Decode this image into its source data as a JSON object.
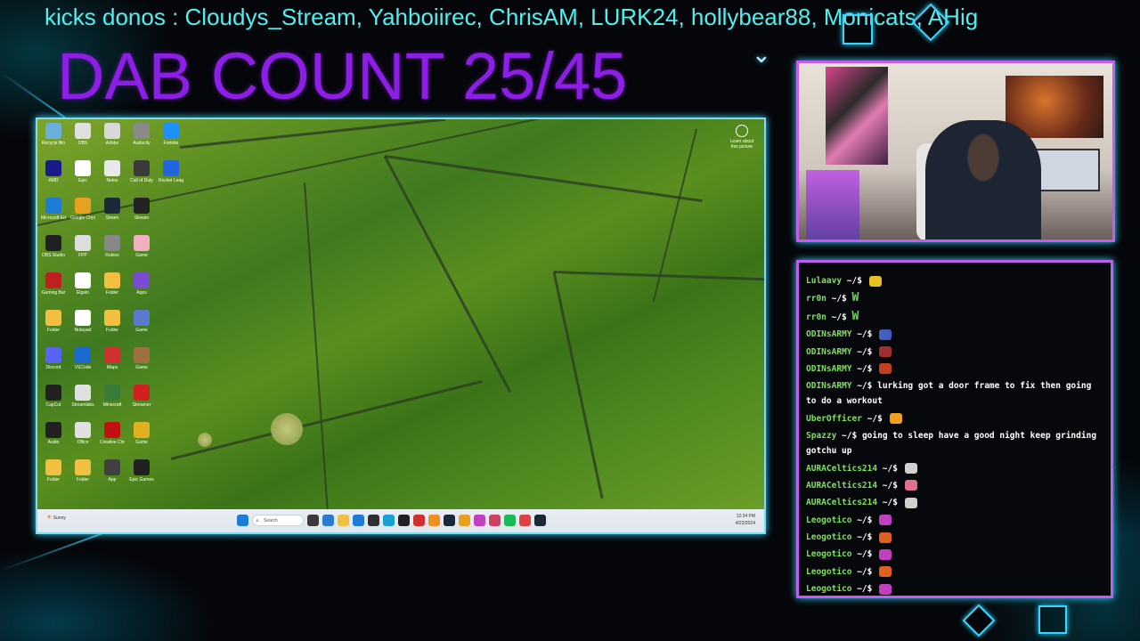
{
  "ticker": {
    "text": "kicks donos : Cloudys_Stream, Yahboiirec, ChrisAM, LURK24, hollybear88, Monicats, AHig"
  },
  "counter": {
    "text": "DAB COUNT 25/45"
  },
  "desktop": {
    "icons": [
      [
        "#6ab0d8",
        "Recycle Bin"
      ],
      [
        "#e0e0e0",
        "OBS"
      ],
      [
        "#d8d8d8",
        "Adobe"
      ],
      [
        "#8a8a8a",
        "Audacity"
      ],
      [
        "#1e90ff",
        "Fortnite"
      ],
      [
        "#1a1a8a",
        "AMD"
      ],
      [
        "#ffffff",
        "Epic"
      ],
      [
        "#e8e8e8",
        "Notes"
      ],
      [
        "#3a3a3a",
        "Call of Duty"
      ],
      [
        "#2266dd",
        "Rocket League"
      ],
      [
        "#1e7bd6",
        "Microsoft Edge"
      ],
      [
        "#e8a020",
        "Google Chrome"
      ],
      [
        "#1b2838",
        "Steam"
      ],
      [
        "#222222",
        "Stream"
      ],
      [
        "#202020",
        "OBS Studio"
      ],
      [
        "#dddddd",
        "FPP"
      ],
      [
        "#888888",
        "Roblox"
      ],
      [
        "#f0b0c0",
        "Game"
      ],
      [
        "#c02020",
        "Gaming Bar"
      ],
      [
        "#ffffff",
        "Elgato"
      ],
      [
        "#f0c040",
        "Folder"
      ],
      [
        "#7a4ad0",
        "Apps"
      ],
      [
        "#f0c040",
        "Folder"
      ],
      [
        "#ffffff",
        "Notepad"
      ],
      [
        "#f0c040",
        "Folder"
      ],
      [
        "#5a7ad0",
        "Game"
      ],
      [
        "#5865f2",
        "Discord"
      ],
      [
        "#1a6ad0",
        "VSCode"
      ],
      [
        "#d03030",
        "Maps"
      ],
      [
        "#a07040",
        "Game"
      ],
      [
        "#202020",
        "CapCut"
      ],
      [
        "#e0e0e0",
        "Streamlabs"
      ],
      [
        "#3a7a3a",
        "Minecraft"
      ],
      [
        "#d02020",
        "Streamer"
      ],
      [
        "#202020",
        "Audio"
      ],
      [
        "#e0e0e0",
        "Office"
      ],
      [
        "#c01010",
        "Creative Cloud"
      ],
      [
        "#e0b020",
        "Game"
      ],
      [
        "#f0c040",
        "Folder"
      ],
      [
        "#f0c040",
        "Folder"
      ],
      [
        "#404040",
        "App"
      ],
      [
        "#202020",
        "Epic Games"
      ]
    ],
    "learn_label": "Learn about this picture",
    "taskbar": {
      "weather": "Sunny",
      "search_placeholder": "Search",
      "time": "12:34 PM",
      "date": "4/22/2024"
    }
  },
  "chat": {
    "messages": [
      {
        "user": "Lulaavy",
        "text": "",
        "emote": "#e8c020"
      },
      {
        "user": "rr0n",
        "text": "W",
        "emote": ""
      },
      {
        "user": "rr0n",
        "text": "W",
        "emote": ""
      },
      {
        "user": "ODINsARMY",
        "text": "",
        "emote": "#4060c0"
      },
      {
        "user": "ODINsARMY",
        "text": "",
        "emote": "#a03030"
      },
      {
        "user": "ODINsARMY",
        "text": "",
        "emote": "#c04020"
      },
      {
        "user": "ODINsARMY",
        "text": "lurking got a door frame to fix then going to do a workout",
        "emote": ""
      },
      {
        "user": "UberOfficer",
        "text": "",
        "emote": "#f0a020"
      },
      {
        "user": "Spazzy",
        "text": "going to sleep have a good night keep grinding gotchu up",
        "emote": ""
      },
      {
        "user": "AURACeltics214",
        "text": "",
        "emote": "#d0d0d0"
      },
      {
        "user": "AURACeltics214",
        "text": "",
        "emote": "#e07090"
      },
      {
        "user": "AURACeltics214",
        "text": "",
        "emote": "#d0d0d0"
      },
      {
        "user": "Leogotico",
        "text": "",
        "emote": "#c040c0"
      },
      {
        "user": "Leogotico",
        "text": "",
        "emote": "#e06020"
      },
      {
        "user": "Leogotico",
        "text": "",
        "emote": "#c040c0"
      },
      {
        "user": "Leogotico",
        "text": "",
        "emote": "#e06020"
      },
      {
        "user": "Leogotico",
        "text": "",
        "emote": "#c040c0"
      }
    ],
    "prompt": "~/$"
  }
}
